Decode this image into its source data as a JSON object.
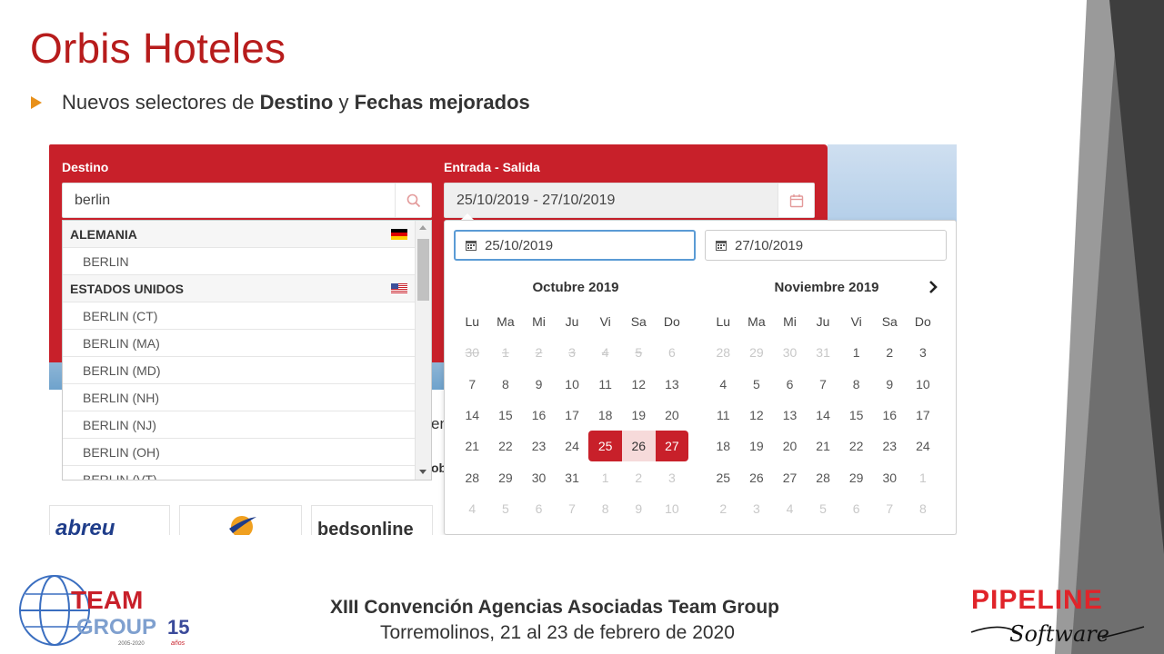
{
  "slide": {
    "title": "Orbis Hoteles",
    "bullet_prefix": "Nuevos selectores de ",
    "bullet_bold1": "Destino",
    "bullet_mid": " y ",
    "bullet_bold2": "Fechas mejorados"
  },
  "search": {
    "destino_label": "Destino",
    "destino_value": "berlin",
    "fechas_label": "Entrada - Salida",
    "fechas_value": "25/10/2019 - 27/10/2019",
    "results": [
      {
        "type": "country",
        "label": "ALEMANIA",
        "flag": "de"
      },
      {
        "type": "city",
        "label": "BERLIN"
      },
      {
        "type": "country",
        "label": "ESTADOS UNIDOS",
        "flag": "us"
      },
      {
        "type": "city",
        "label": "BERLIN (CT)"
      },
      {
        "type": "city",
        "label": "BERLIN (MA)"
      },
      {
        "type": "city",
        "label": "BERLIN (MD)"
      },
      {
        "type": "city",
        "label": "BERLIN (NH)"
      },
      {
        "type": "city",
        "label": "BERLIN (NJ)"
      },
      {
        "type": "city",
        "label": "BERLIN (OH)"
      },
      {
        "type": "city",
        "label": "BERLIN (VT)"
      }
    ]
  },
  "calendar": {
    "start_input": "25/10/2019",
    "end_input": "27/10/2019",
    "weekdays": [
      "Lu",
      "Ma",
      "Mi",
      "Ju",
      "Vi",
      "Sa",
      "Do"
    ],
    "months": [
      {
        "title": "Octubre 2019",
        "days": [
          {
            "d": "30",
            "s": "strike"
          },
          {
            "d": "1",
            "s": "strike"
          },
          {
            "d": "2",
            "s": "strike"
          },
          {
            "d": "3",
            "s": "strike"
          },
          {
            "d": "4",
            "s": "strike"
          },
          {
            "d": "5",
            "s": "strike"
          },
          {
            "d": "6",
            "s": "dis"
          },
          {
            "d": "7"
          },
          {
            "d": "8"
          },
          {
            "d": "9"
          },
          {
            "d": "10"
          },
          {
            "d": "11"
          },
          {
            "d": "12"
          },
          {
            "d": "13"
          },
          {
            "d": "14"
          },
          {
            "d": "15"
          },
          {
            "d": "16"
          },
          {
            "d": "17"
          },
          {
            "d": "18"
          },
          {
            "d": "19"
          },
          {
            "d": "20"
          },
          {
            "d": "21"
          },
          {
            "d": "22"
          },
          {
            "d": "23"
          },
          {
            "d": "24"
          },
          {
            "d": "25",
            "s": "sel sel-start"
          },
          {
            "d": "26",
            "s": "range"
          },
          {
            "d": "27",
            "s": "sel sel-end"
          },
          {
            "d": "28"
          },
          {
            "d": "29"
          },
          {
            "d": "30"
          },
          {
            "d": "31"
          },
          {
            "d": "1",
            "s": "dis"
          },
          {
            "d": "2",
            "s": "dis"
          },
          {
            "d": "3",
            "s": "dis"
          },
          {
            "d": "4",
            "s": "dis"
          },
          {
            "d": "5",
            "s": "dis"
          },
          {
            "d": "6",
            "s": "dis"
          },
          {
            "d": "7",
            "s": "dis"
          },
          {
            "d": "8",
            "s": "dis"
          },
          {
            "d": "9",
            "s": "dis"
          },
          {
            "d": "10",
            "s": "dis"
          }
        ]
      },
      {
        "title": "Noviembre 2019",
        "days": [
          {
            "d": "28",
            "s": "dis"
          },
          {
            "d": "29",
            "s": "dis"
          },
          {
            "d": "30",
            "s": "dis"
          },
          {
            "d": "31",
            "s": "dis"
          },
          {
            "d": "1"
          },
          {
            "d": "2"
          },
          {
            "d": "3"
          },
          {
            "d": "4"
          },
          {
            "d": "5"
          },
          {
            "d": "6"
          },
          {
            "d": "7"
          },
          {
            "d": "8"
          },
          {
            "d": "9"
          },
          {
            "d": "10"
          },
          {
            "d": "11"
          },
          {
            "d": "12"
          },
          {
            "d": "13"
          },
          {
            "d": "14"
          },
          {
            "d": "15"
          },
          {
            "d": "16"
          },
          {
            "d": "17"
          },
          {
            "d": "18"
          },
          {
            "d": "19"
          },
          {
            "d": "20"
          },
          {
            "d": "21"
          },
          {
            "d": "22"
          },
          {
            "d": "23"
          },
          {
            "d": "24"
          },
          {
            "d": "25"
          },
          {
            "d": "26"
          },
          {
            "d": "27"
          },
          {
            "d": "28"
          },
          {
            "d": "29"
          },
          {
            "d": "30"
          },
          {
            "d": "1",
            "s": "dis"
          },
          {
            "d": "2",
            "s": "dis"
          },
          {
            "d": "3",
            "s": "dis"
          },
          {
            "d": "4",
            "s": "dis"
          },
          {
            "d": "5",
            "s": "dis"
          },
          {
            "d": "6",
            "s": "dis"
          },
          {
            "d": "7",
            "s": "dis"
          },
          {
            "d": "8",
            "s": "dis"
          }
        ]
      }
    ]
  },
  "background": {
    "partial_text_1": "en",
    "partial_text_2": "ob",
    "logo_1": "abreu",
    "logo_3": "bedsonline"
  },
  "footer": {
    "title": "XIII Convención Agencias Asociadas Team Group",
    "subtitle": "Torremolinos, 21 al 23 de febrero de 2020",
    "team_logo_line1": "TEAM",
    "team_logo_line2": "GROUP",
    "team_logo_years": "15",
    "team_logo_anos": "años",
    "team_logo_range": "2005-2020",
    "pipeline_logo_1": "PIPELINE",
    "pipeline_logo_2": "Software"
  },
  "colors": {
    "title_red": "#b71c1c",
    "panel_red": "#c8202a",
    "bullet_orange": "#e8901a",
    "selection_blue": "#5b9bd5"
  }
}
